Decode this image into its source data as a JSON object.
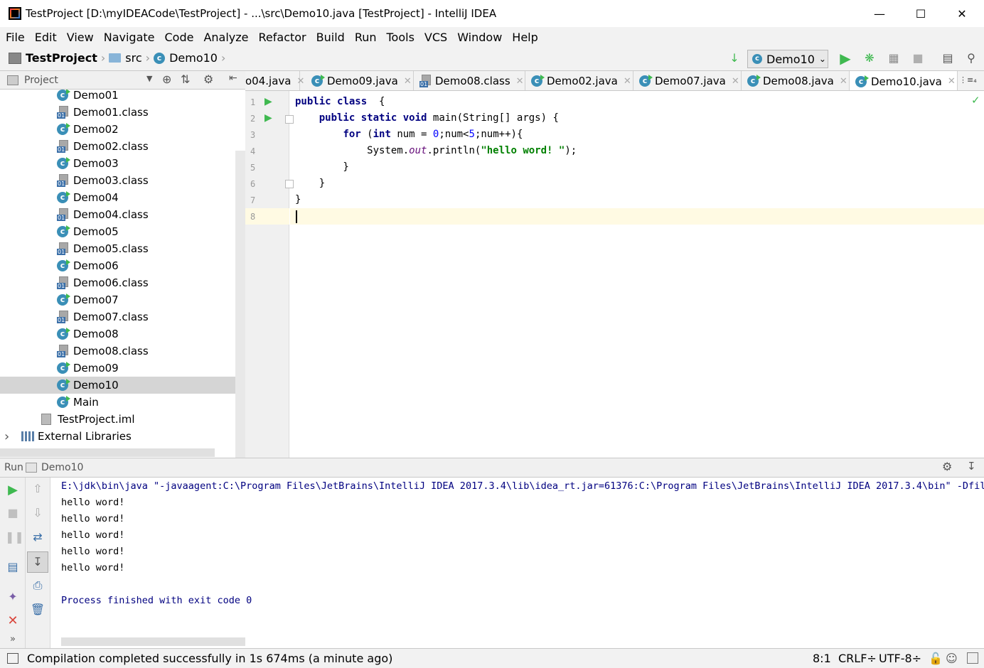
{
  "window": {
    "title": "TestProject [D:\\myIDEACode\\TestProject] - ...\\src\\Demo10.java [TestProject] - IntelliJ IDEA"
  },
  "menu": [
    "File",
    "Edit",
    "View",
    "Navigate",
    "Code",
    "Analyze",
    "Refactor",
    "Build",
    "Run",
    "Tools",
    "VCS",
    "Window",
    "Help"
  ],
  "breadcrumb": {
    "project": "TestProject",
    "folder": "src",
    "file": "Demo10"
  },
  "run_config": {
    "selected": "Demo10"
  },
  "project_panel": {
    "title": "Project",
    "items": [
      {
        "label": "Demo01",
        "icon": "java-class-icon"
      },
      {
        "label": "Demo01.class",
        "icon": "class-file-icon"
      },
      {
        "label": "Demo02",
        "icon": "java-class-icon"
      },
      {
        "label": "Demo02.class",
        "icon": "class-file-icon"
      },
      {
        "label": "Demo03",
        "icon": "java-class-icon"
      },
      {
        "label": "Demo03.class",
        "icon": "class-file-icon"
      },
      {
        "label": "Demo04",
        "icon": "java-class-icon"
      },
      {
        "label": "Demo04.class",
        "icon": "class-file-icon"
      },
      {
        "label": "Demo05",
        "icon": "java-class-icon"
      },
      {
        "label": "Demo05.class",
        "icon": "class-file-icon"
      },
      {
        "label": "Demo06",
        "icon": "java-class-icon"
      },
      {
        "label": "Demo06.class",
        "icon": "class-file-icon"
      },
      {
        "label": "Demo07",
        "icon": "java-class-icon"
      },
      {
        "label": "Demo07.class",
        "icon": "class-file-icon"
      },
      {
        "label": "Demo08",
        "icon": "java-class-icon"
      },
      {
        "label": "Demo08.class",
        "icon": "class-file-icon"
      },
      {
        "label": "Demo09",
        "icon": "java-class-icon"
      },
      {
        "label": "Demo10",
        "icon": "java-class-icon",
        "selected": true
      },
      {
        "label": "Main",
        "icon": "java-class-icon"
      },
      {
        "label": "TestProject.iml",
        "icon": "iml-file-icon"
      },
      {
        "label": "External Libraries",
        "icon": "libraries-icon"
      }
    ]
  },
  "tabs": [
    {
      "label": "o04.java",
      "icon": "java-class-icon"
    },
    {
      "label": "Demo09.java",
      "icon": "java-class-icon"
    },
    {
      "label": "Demo08.class",
      "icon": "class-file-icon"
    },
    {
      "label": "Demo02.java",
      "icon": "java-class-icon"
    },
    {
      "label": "Demo07.java",
      "icon": "java-class-icon"
    },
    {
      "label": "Demo08.java",
      "icon": "java-class-icon"
    },
    {
      "label": "Demo10.java",
      "icon": "java-class-icon",
      "active": true
    }
  ],
  "tabs_overflow": "⋮≡₄",
  "editor": {
    "line_numbers": [
      "1",
      "2",
      "3",
      "4",
      "5",
      "6",
      "7",
      "8"
    ],
    "lines": [
      "public class Demo10 {",
      "    public static void main(String[] args) {",
      "        for (int num = 0;num<5;num++){",
      "            System.out.println(\"hello word! \");",
      "        }",
      "    }",
      "}",
      ""
    ]
  },
  "run_panel": {
    "tab_label": "Run",
    "config": "Demo10",
    "command": "E:\\jdk\\bin\\java \"-javaagent:C:\\Program Files\\JetBrains\\IntelliJ IDEA 2017.3.4\\lib\\idea_rt.jar=61376:C:\\Program Files\\JetBrains\\IntelliJ IDEA 2017.3.4\\bin\" -Dfile.",
    "output": [
      "hello word!",
      "hello word!",
      "hello word!",
      "hello word!",
      "hello word!"
    ],
    "exit": "Process finished with exit code 0"
  },
  "status_bar": {
    "message": "Compilation completed successfully in 1s 674ms (a minute ago)",
    "position": "8:1",
    "line_sep": "CRLF÷",
    "encoding": "UTF-8÷"
  },
  "colors": {
    "keyword": "#000080",
    "string": "#008000",
    "number": "#0000ff",
    "run_green": "#3fb950",
    "caret_row": "#fffae3"
  }
}
